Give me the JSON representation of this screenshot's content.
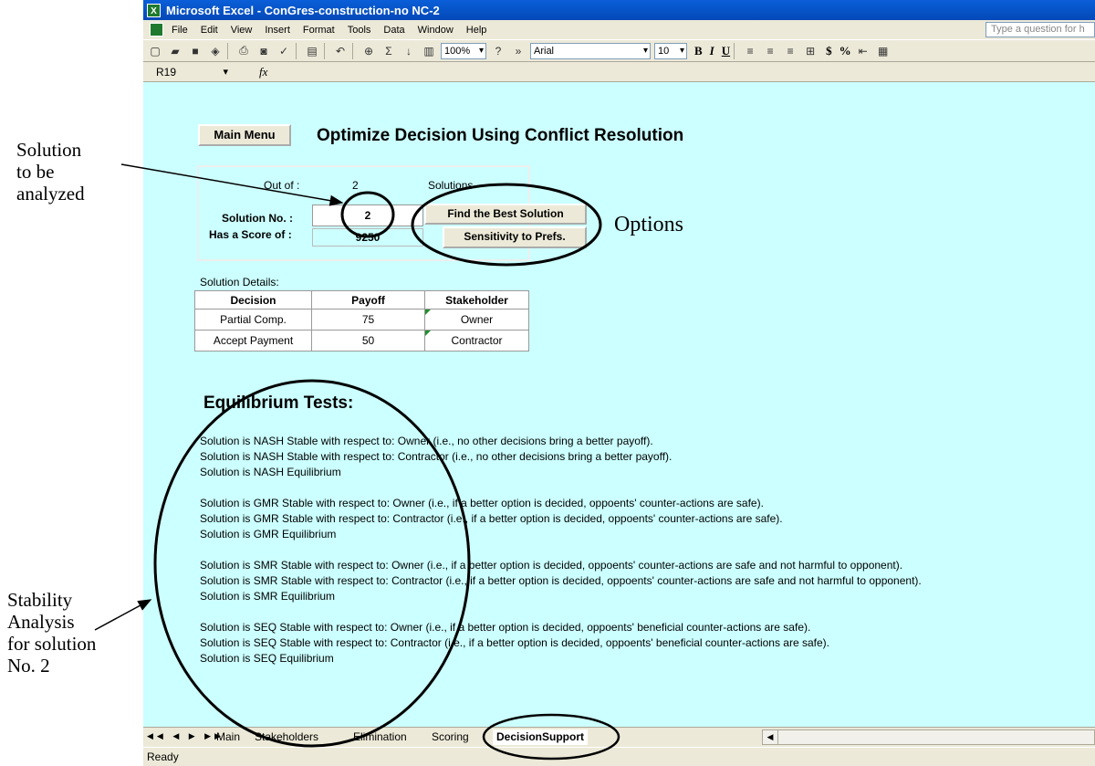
{
  "window": {
    "title": "Microsoft Excel - ConGres-construction-no NC-2"
  },
  "menu": {
    "items": [
      "File",
      "Edit",
      "View",
      "Insert",
      "Format",
      "Tools",
      "Data",
      "Window",
      "Help"
    ],
    "question_placeholder": "Type a question for h"
  },
  "toolbar": {
    "zoom": "100%",
    "font": "Arial",
    "size": "10",
    "bold": "B",
    "italic": "I",
    "underline": "U",
    "currency": "$",
    "percent": "%"
  },
  "formula_bar": {
    "name_box": "R19",
    "fx": "fx"
  },
  "sheet": {
    "main_menu": "Main Menu",
    "title": "Optimize Decision Using Conflict Resolution",
    "out_of_label": "Out of :",
    "out_of_value": "2",
    "solutions_label": "Solutions",
    "solution_no_label": "Solution No. :",
    "solution_no_value": "2",
    "score_label": "Has a Score of :",
    "score_value": "9250",
    "find_best": "Find the Best Solution",
    "sensitivity": "Sensitivity to Prefs.",
    "details_label": "Solution Details:",
    "table": {
      "headers": [
        "Decision",
        "Payoff",
        "Stakeholder"
      ],
      "rows": [
        [
          "Partial Comp.",
          "75",
          "Owner"
        ],
        [
          "Accept Payment",
          "50",
          "Contractor"
        ]
      ]
    },
    "eq_heading": "Equilibrium Tests:",
    "eq_lines": [
      "Solution is NASH Stable with respect to: Owner (i.e., no other decisions bring a better payoff).",
      "Solution is NASH Stable with respect to: Contractor (i.e., no other decisions bring a better payoff).",
      "Solution is NASH Equilibrium",
      "Solution is GMR Stable with respect to: Owner (i.e., if a better option is decided, oppoents' counter-actions are safe).",
      "Solution is GMR Stable with respect to: Contractor (i.e., if a better option is decided, oppoents' counter-actions are safe).",
      "Solution is GMR Equilibrium",
      "Solution is SMR Stable with respect to: Owner (i.e., if a better option is decided, oppoents' counter-actions are safe and not harmful to opponent).",
      "Solution is SMR Stable with respect to: Contractor (i.e., if a better option is decided, oppoents' counter-actions are safe and not harmful to opponent).",
      "Solution is SMR Equilibrium",
      "Solution is SEQ Stable with respect to: Owner (i.e., if a better option is decided, oppoents' beneficial counter-actions are safe).",
      "Solution is SEQ Stable with respect to: Contractor (i.e., if a better option is decided, oppoents' beneficial counter-actions are safe).",
      "Solution is SEQ Equilibrium"
    ]
  },
  "tabs": [
    "Main",
    "Stakeholders",
    "Elimination",
    "Scoring",
    "DecisionSupport"
  ],
  "status": "Ready",
  "annotations": {
    "solution": [
      "Solution",
      "to be",
      "analyzed"
    ],
    "options": "Options",
    "stability": [
      "Stability",
      "Analysis",
      "for solution",
      "No. 2"
    ]
  }
}
